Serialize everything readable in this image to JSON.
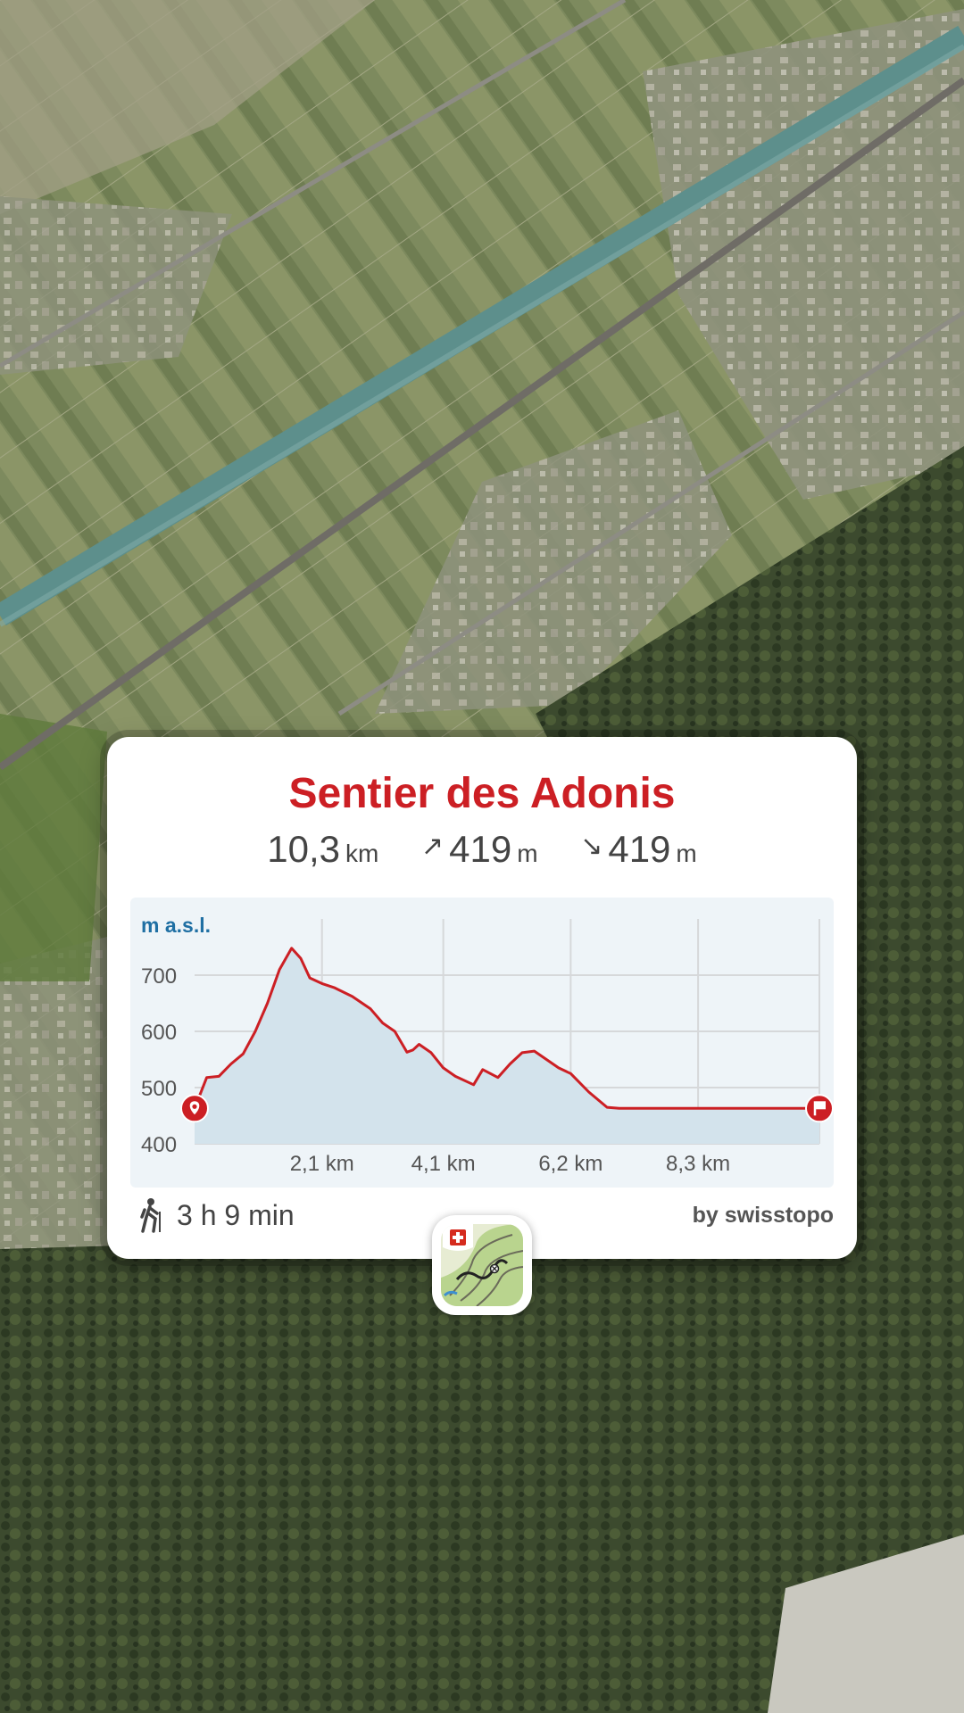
{
  "route": {
    "title": "Sentier des Adonis",
    "distance": {
      "value": "10,3",
      "unit": "km"
    },
    "ascent": {
      "value": "419",
      "unit": "m"
    },
    "descent": {
      "value": "419",
      "unit": "m"
    },
    "duration": "3 h 9 min",
    "credit": "by swisstopo"
  },
  "icons": {
    "ascent": "arrow-up-right-icon",
    "descent": "arrow-down-right-icon",
    "start": "start-pin-icon",
    "finish": "finish-flag-icon",
    "hiker": "hiker-icon",
    "app": "swisstopo-app-icon"
  },
  "colors": {
    "accent": "#cc1f24",
    "axis_title": "#1f6fa3",
    "profile_fill": "#d3e3ec",
    "chart_bg": "#eef4f8"
  },
  "chart_data": {
    "type": "area",
    "ylabel": "m a.s.l.",
    "xlabel": "",
    "xlim": [
      0,
      10.3
    ],
    "ylim": [
      400,
      800
    ],
    "xticks": [
      2.1,
      4.1,
      6.2,
      8.3
    ],
    "xtick_labels": [
      "2,1 km",
      "4,1 km",
      "6,2 km",
      "8,3 km"
    ],
    "yticks": [
      400,
      500,
      600,
      700
    ],
    "grid": true,
    "series": [
      {
        "x": [
          0,
          0.2,
          0.4,
          0.6,
          0.8,
          1.0,
          1.2,
          1.4,
          1.6,
          1.75,
          1.9,
          2.1,
          2.3,
          2.6,
          2.9,
          3.1,
          3.3,
          3.5,
          3.6,
          3.7,
          3.9,
          4.1,
          4.3,
          4.6,
          4.75,
          5.0,
          5.2,
          5.4,
          5.6,
          5.8,
          6.0,
          6.2,
          6.5,
          6.8,
          7.0,
          7.2,
          7.5,
          8.0,
          9.0,
          10.3
        ],
        "y": [
          463,
          518,
          520,
          542,
          560,
          600,
          650,
          710,
          748,
          730,
          695,
          685,
          678,
          662,
          640,
          615,
          600,
          563,
          567,
          577,
          562,
          535,
          520,
          505,
          532,
          518,
          542,
          562,
          565,
          550,
          535,
          525,
          492,
          465,
          463,
          463,
          463,
          463,
          463,
          463
        ]
      }
    ]
  }
}
